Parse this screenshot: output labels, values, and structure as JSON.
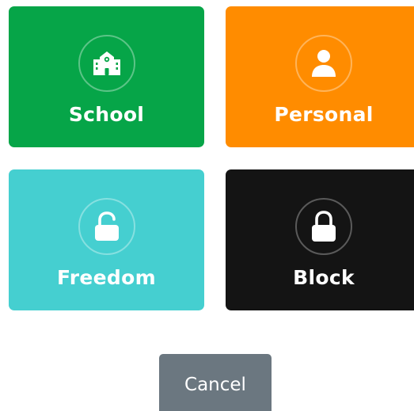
{
  "tiles": [
    {
      "id": "school",
      "label": "School",
      "icon": "school-building-icon",
      "color": "#06a548"
    },
    {
      "id": "personal",
      "label": "Personal",
      "icon": "person-icon",
      "color": "#ff8c00"
    },
    {
      "id": "freedom",
      "label": "Freedom",
      "icon": "unlocked-padlock-icon",
      "color": "#45cfd0"
    },
    {
      "id": "block",
      "label": "Block",
      "icon": "locked-padlock-icon",
      "color": "#141414"
    }
  ],
  "cancel": {
    "label": "Cancel",
    "color": "#6b7780"
  }
}
